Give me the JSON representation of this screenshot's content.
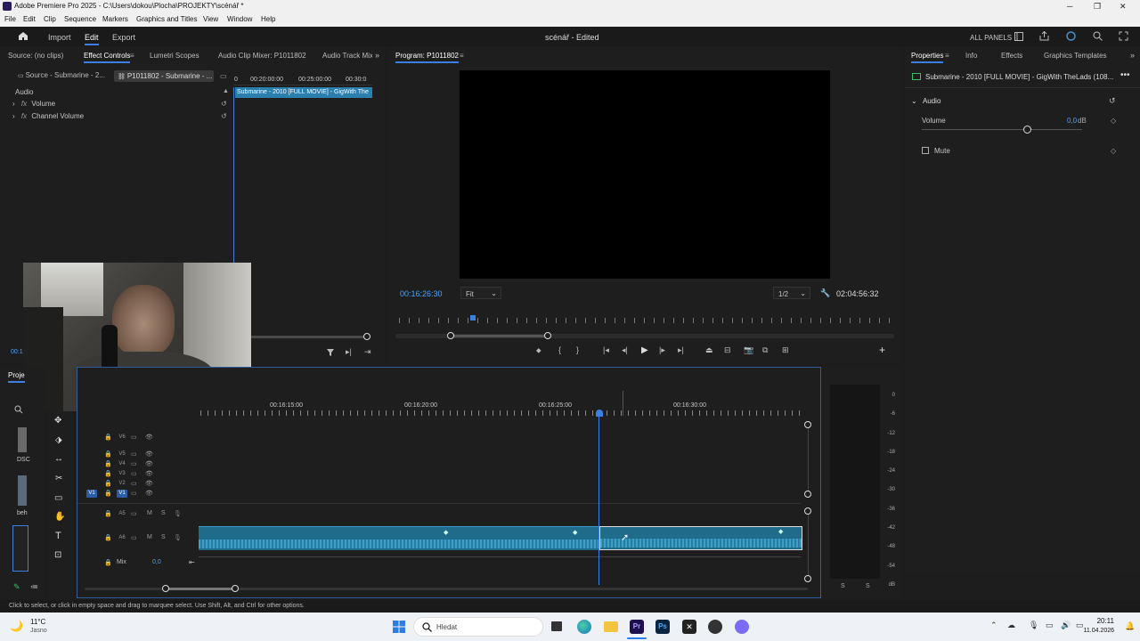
{
  "window": {
    "title": "Adobe Premiere Pro 2025 - C:\\Users\\dokou\\Plocha\\PROJEKTY\\scénář *",
    "controls": [
      "─",
      "❐",
      "✕"
    ]
  },
  "menu": [
    "File",
    "Edit",
    "Clip",
    "Sequence",
    "Markers",
    "Graphics and Titles",
    "View",
    "Window",
    "Help"
  ],
  "header": {
    "nav": [
      "Import",
      "Edit",
      "Export"
    ],
    "active": "Edit",
    "project_title": "scénář - Edited",
    "all_panels": "ALL PANELS"
  },
  "source_panel": {
    "tabs": [
      "Source: (no clips)",
      "Effect Controls",
      "Lumetri Scopes",
      "Audio Clip Mixer: P1011802",
      "Audio Track Mixe"
    ],
    "active_tab": "Effect Controls",
    "subtabs": [
      "Source - Submarine - 2...",
      "P1011802 - Submarine - ..."
    ],
    "section": "Audio",
    "effects": [
      "Volume",
      "Channel Volume"
    ],
    "clip_name": "Submarine - 2010 [FULL MOVIE] - GigWith The",
    "ruler": [
      "00:20:00:00",
      "00:25:00:00",
      "00:30:0"
    ],
    "ruler_start": "0",
    "timecode_partial": "00:1"
  },
  "program": {
    "title": "Program: P1011802",
    "timecode": "00:16:26:30",
    "fit": "Fit",
    "resolution": "1/2",
    "duration": "02:04:56:32"
  },
  "properties": {
    "tabs": [
      "Properties",
      "Info",
      "Effects",
      "Graphics Templates"
    ],
    "active_tab": "Properties",
    "clip": "Submarine - 2010 [FULL MOVIE] - GigWith TheLads (108...",
    "section": "Audio",
    "volume_label": "Volume",
    "volume_value": "0,0",
    "volume_unit": "dB",
    "mute_label": "Mute"
  },
  "project_panel": {
    "tab_partial": "Proje",
    "items": [
      "DSC",
      "beh"
    ]
  },
  "timeline": {
    "ruler": [
      "00:16:15:00",
      "00:16:20:00",
      "00:16:25:00",
      "00:16:30:00"
    ],
    "video_tracks": [
      "V6",
      "V5",
      "V4",
      "V3",
      "V2",
      "V1"
    ],
    "audio_tracks": [
      "A5",
      "A6"
    ],
    "mix_label": "Mix",
    "mix_value": "0,0",
    "track_flags": [
      "M",
      "S"
    ],
    "source_patch": "V1"
  },
  "meter": {
    "scale": [
      "0",
      "-6",
      "-12",
      "-18",
      "-24",
      "-30",
      "-36",
      "-42",
      "-48",
      "-54",
      "dB"
    ],
    "solo": [
      "S",
      "S"
    ]
  },
  "status": "Click to select, or click in empty space and drag to marquee select. Use Shift, Alt, and Ctrl for other options.",
  "taskbar": {
    "weather_temp": "11°C",
    "weather_desc": "Jasno",
    "search_placeholder": "Hledat",
    "time": "20:11",
    "date": "11.04.2026"
  }
}
